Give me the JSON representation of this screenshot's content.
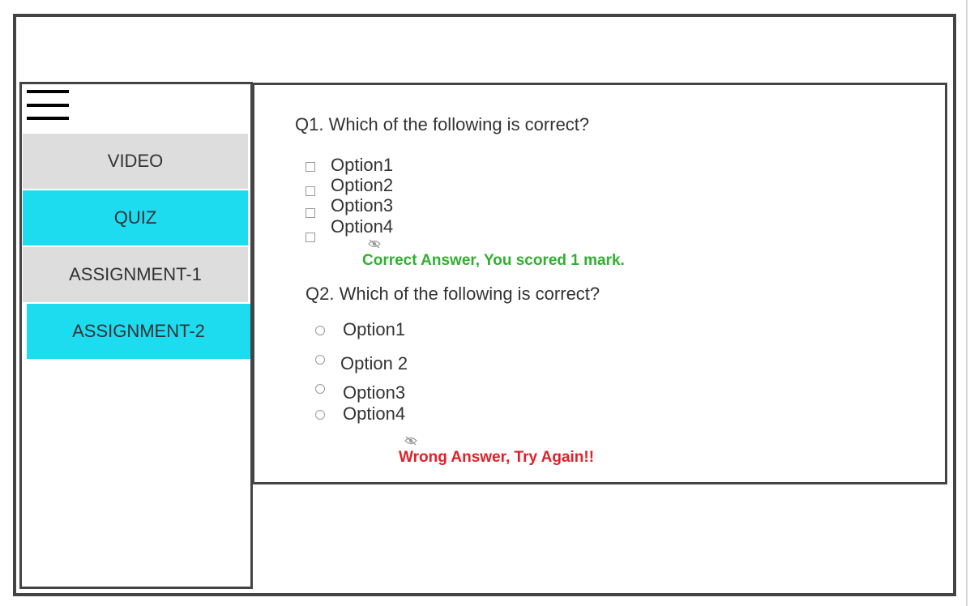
{
  "colors": {
    "accent": "#1edcf0",
    "neutral_tab": "#dddddd",
    "border": "#444444",
    "correct": "#2fb02f",
    "wrong": "#e0202a"
  },
  "sidebar": {
    "menu_icon": "hamburger-menu-icon",
    "items": [
      {
        "label": "VIDEO",
        "active": false
      },
      {
        "label": "QUIZ",
        "active": true
      },
      {
        "label": "ASSIGNMENT-1",
        "active": false
      },
      {
        "label": "ASSIGNMENT-2",
        "active": true
      }
    ]
  },
  "quiz": {
    "q1": {
      "question": "Q1. Which of the following is correct?",
      "input_type": "checkbox",
      "options": [
        "Option1",
        "Option2",
        "Option3",
        "Option4"
      ],
      "feedback_icon": "eye-hidden-icon",
      "feedback": "Correct Answer, You scored 1 mark."
    },
    "q2": {
      "question": "Q2. Which of the following is correct?",
      "input_type": "radio",
      "options": [
        "Option1",
        "Option 2",
        "Option3",
        "Option4"
      ],
      "feedback_icon": "eye-hidden-icon",
      "feedback": "Wrong Answer, Try Again!!"
    }
  }
}
